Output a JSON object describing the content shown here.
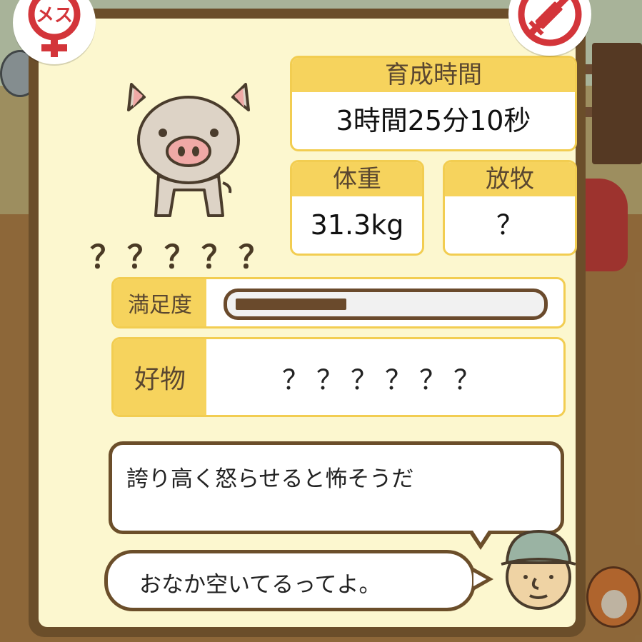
{
  "badges": {
    "gender_label": "メス",
    "gender_icon": "female-symbol-icon",
    "no_injection_icon": "no-syringe-icon"
  },
  "pig": {
    "name": "？？？？？"
  },
  "stats": {
    "growth_time": {
      "label": "育成時間",
      "value": "3時間25分10秒"
    },
    "weight": {
      "label": "体重",
      "value": "31.3kg"
    },
    "grazing": {
      "label": "放牧",
      "value": "？"
    }
  },
  "satisfaction": {
    "label": "満足度",
    "level": 0.37
  },
  "favorite": {
    "label": "好物",
    "value": "？？？？？？"
  },
  "description": "誇り高く怒らせると怖そうだ",
  "farmer_message": "おなか空いてるってよ。",
  "colors": {
    "panel_border": "#6b4e2a",
    "panel_bg": "#fcf7cf",
    "label_bg": "#f6d35d",
    "female_red": "#d3353a",
    "bar_fill": "#6a4a2c"
  }
}
